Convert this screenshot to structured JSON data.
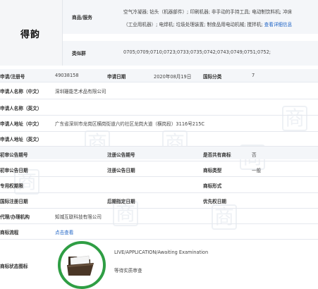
{
  "brand": {
    "name": "得韵"
  },
  "goods": {
    "label": "商品/服务",
    "line1": "空气冷凝器; 钻头（机器部件）; 印刷机器; 非手动的手持工具; 电动制饮料机; 冲床",
    "line2": "（工业用机器）; 电焊机; 垃圾处理装置; 制食品用电动机械; 搅拌机;",
    "more_link": "查看详细信息"
  },
  "similar_group": {
    "label": "类似群",
    "value": "0705;0709;0710;0723;0733;0735;0742;0743;0749;0751;0752;"
  },
  "rows": {
    "reg_no_label": "申请/注册号",
    "reg_no_value": "49038158",
    "apply_date_label": "申请日期",
    "apply_date_value": "2020年08月19日",
    "intl_class_label": "国际分类",
    "intl_class_value": "7",
    "applicant_cn_label": "申请人名称（中文）",
    "applicant_cn_value": "深圳珊能艺术品有限公司",
    "applicant_en_label": "申请人名称（英文）",
    "address_cn_label": "申请人地址（中文）",
    "address_cn_value": "广东省深圳市龙岗区横岗街道六约社区龙岗大道（横岗段）3116号215C",
    "address_en_label": "申请人地址（英文）",
    "prelim_no_label": "初审公告期号",
    "reg_notice_no_label": "注册公告期号",
    "shared_label": "是否共有商标",
    "shared_value": "否",
    "prelim_date_label": "初审公告日期",
    "reg_notice_date_label": "注册公告日期",
    "type_label": "商标类型",
    "type_value": "一般",
    "exclusive_label": "专用权期限",
    "form_label": "商标形式",
    "intl_reg_date_label": "国际注册日期",
    "later_date_label": "后期指定日期",
    "priority_date_label": "优先权日期",
    "agent_label": "代理/办理机构",
    "agent_value": "知城互联科技有限公司",
    "process_label": "商标流程",
    "process_link": "点击查看",
    "status_label": "商标状态图标",
    "status_en": "LIVE/APPLICATION/Awaiting Examination",
    "status_cn": "等待实质审查"
  },
  "watermark": {
    "char": "商"
  },
  "colors": {
    "link": "#1e63c5",
    "status_ring": "#2f9e44",
    "folder": "#3a2a1e",
    "band": "#f4f6f9"
  },
  "icons": {
    "status": "open-folder-icon"
  }
}
